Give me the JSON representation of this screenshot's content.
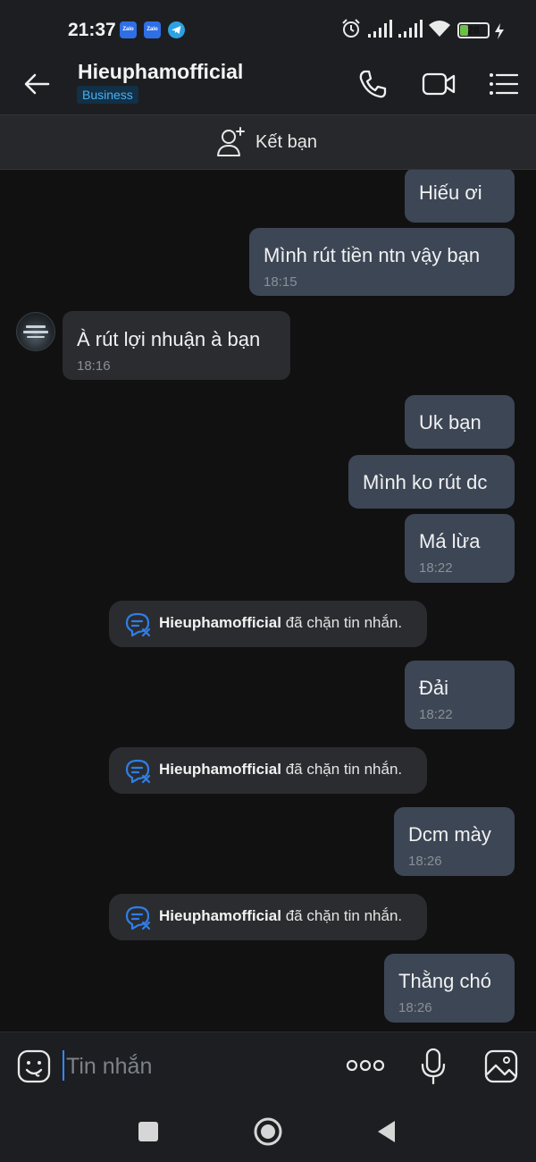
{
  "status_bar": {
    "time": "21:37",
    "app_icons": [
      "zalo-icon",
      "zalo-icon",
      "telegram-icon"
    ],
    "app_icon_label": "Zalo",
    "right_icons": [
      "alarm-icon",
      "signal-icon",
      "signal-icon",
      "wifi-icon"
    ],
    "battery_level": "28",
    "battery_fraction": 0.28,
    "charging": true
  },
  "header": {
    "contact_name": "Hieuphamofficial",
    "badge": "Business",
    "badge_color": "#4ab0f2",
    "actions": [
      "call-icon",
      "video-call-icon",
      "menu-icon"
    ]
  },
  "add_friend": {
    "label": "Kết bạn",
    "icon": "add-friend-icon"
  },
  "messages": [
    {
      "direction": "outgoing",
      "text": "Hiếu ơi",
      "time": ""
    },
    {
      "direction": "outgoing",
      "text": "Mình rút tiền ntn vậy bạn",
      "time": "18:15"
    },
    {
      "direction": "incoming",
      "text": "À rút lợi nhuận à bạn",
      "time": "18:16"
    },
    {
      "direction": "outgoing",
      "text": "Uk bạn",
      "time": ""
    },
    {
      "direction": "outgoing",
      "text": "Mình ko rút dc",
      "time": ""
    },
    {
      "direction": "outgoing",
      "text": "Má lừa",
      "time": "18:22"
    },
    {
      "direction": "system",
      "name": "Hieuphamofficial",
      "text": "đã chặn tin nhắn."
    },
    {
      "direction": "outgoing",
      "text": "Đải",
      "time": "18:22"
    },
    {
      "direction": "system",
      "name": "Hieuphamofficial",
      "text": "đã chặn tin nhắn."
    },
    {
      "direction": "outgoing",
      "text": "Dcm mày",
      "time": "18:26"
    },
    {
      "direction": "system",
      "name": "Hieuphamofficial",
      "text": "đã chặn tin nhắn."
    },
    {
      "direction": "outgoing",
      "text": "Thằng chó",
      "time": "18:26"
    }
  ],
  "input_bar": {
    "placeholder": "Tin nhắn",
    "value": "",
    "icons": [
      "emoji-icon",
      "more-icon",
      "microphone-icon",
      "image-icon"
    ],
    "cursor_color": "#2f8cff"
  },
  "nav_bar": {
    "buttons": [
      "recent-apps-icon",
      "home-icon",
      "back-icon"
    ]
  },
  "colors": {
    "background": "#111112",
    "outgoing_bubble": "#3d4654",
    "incoming_bubble": "#2b2c2f",
    "system_icon": "#2f7ee8"
  }
}
